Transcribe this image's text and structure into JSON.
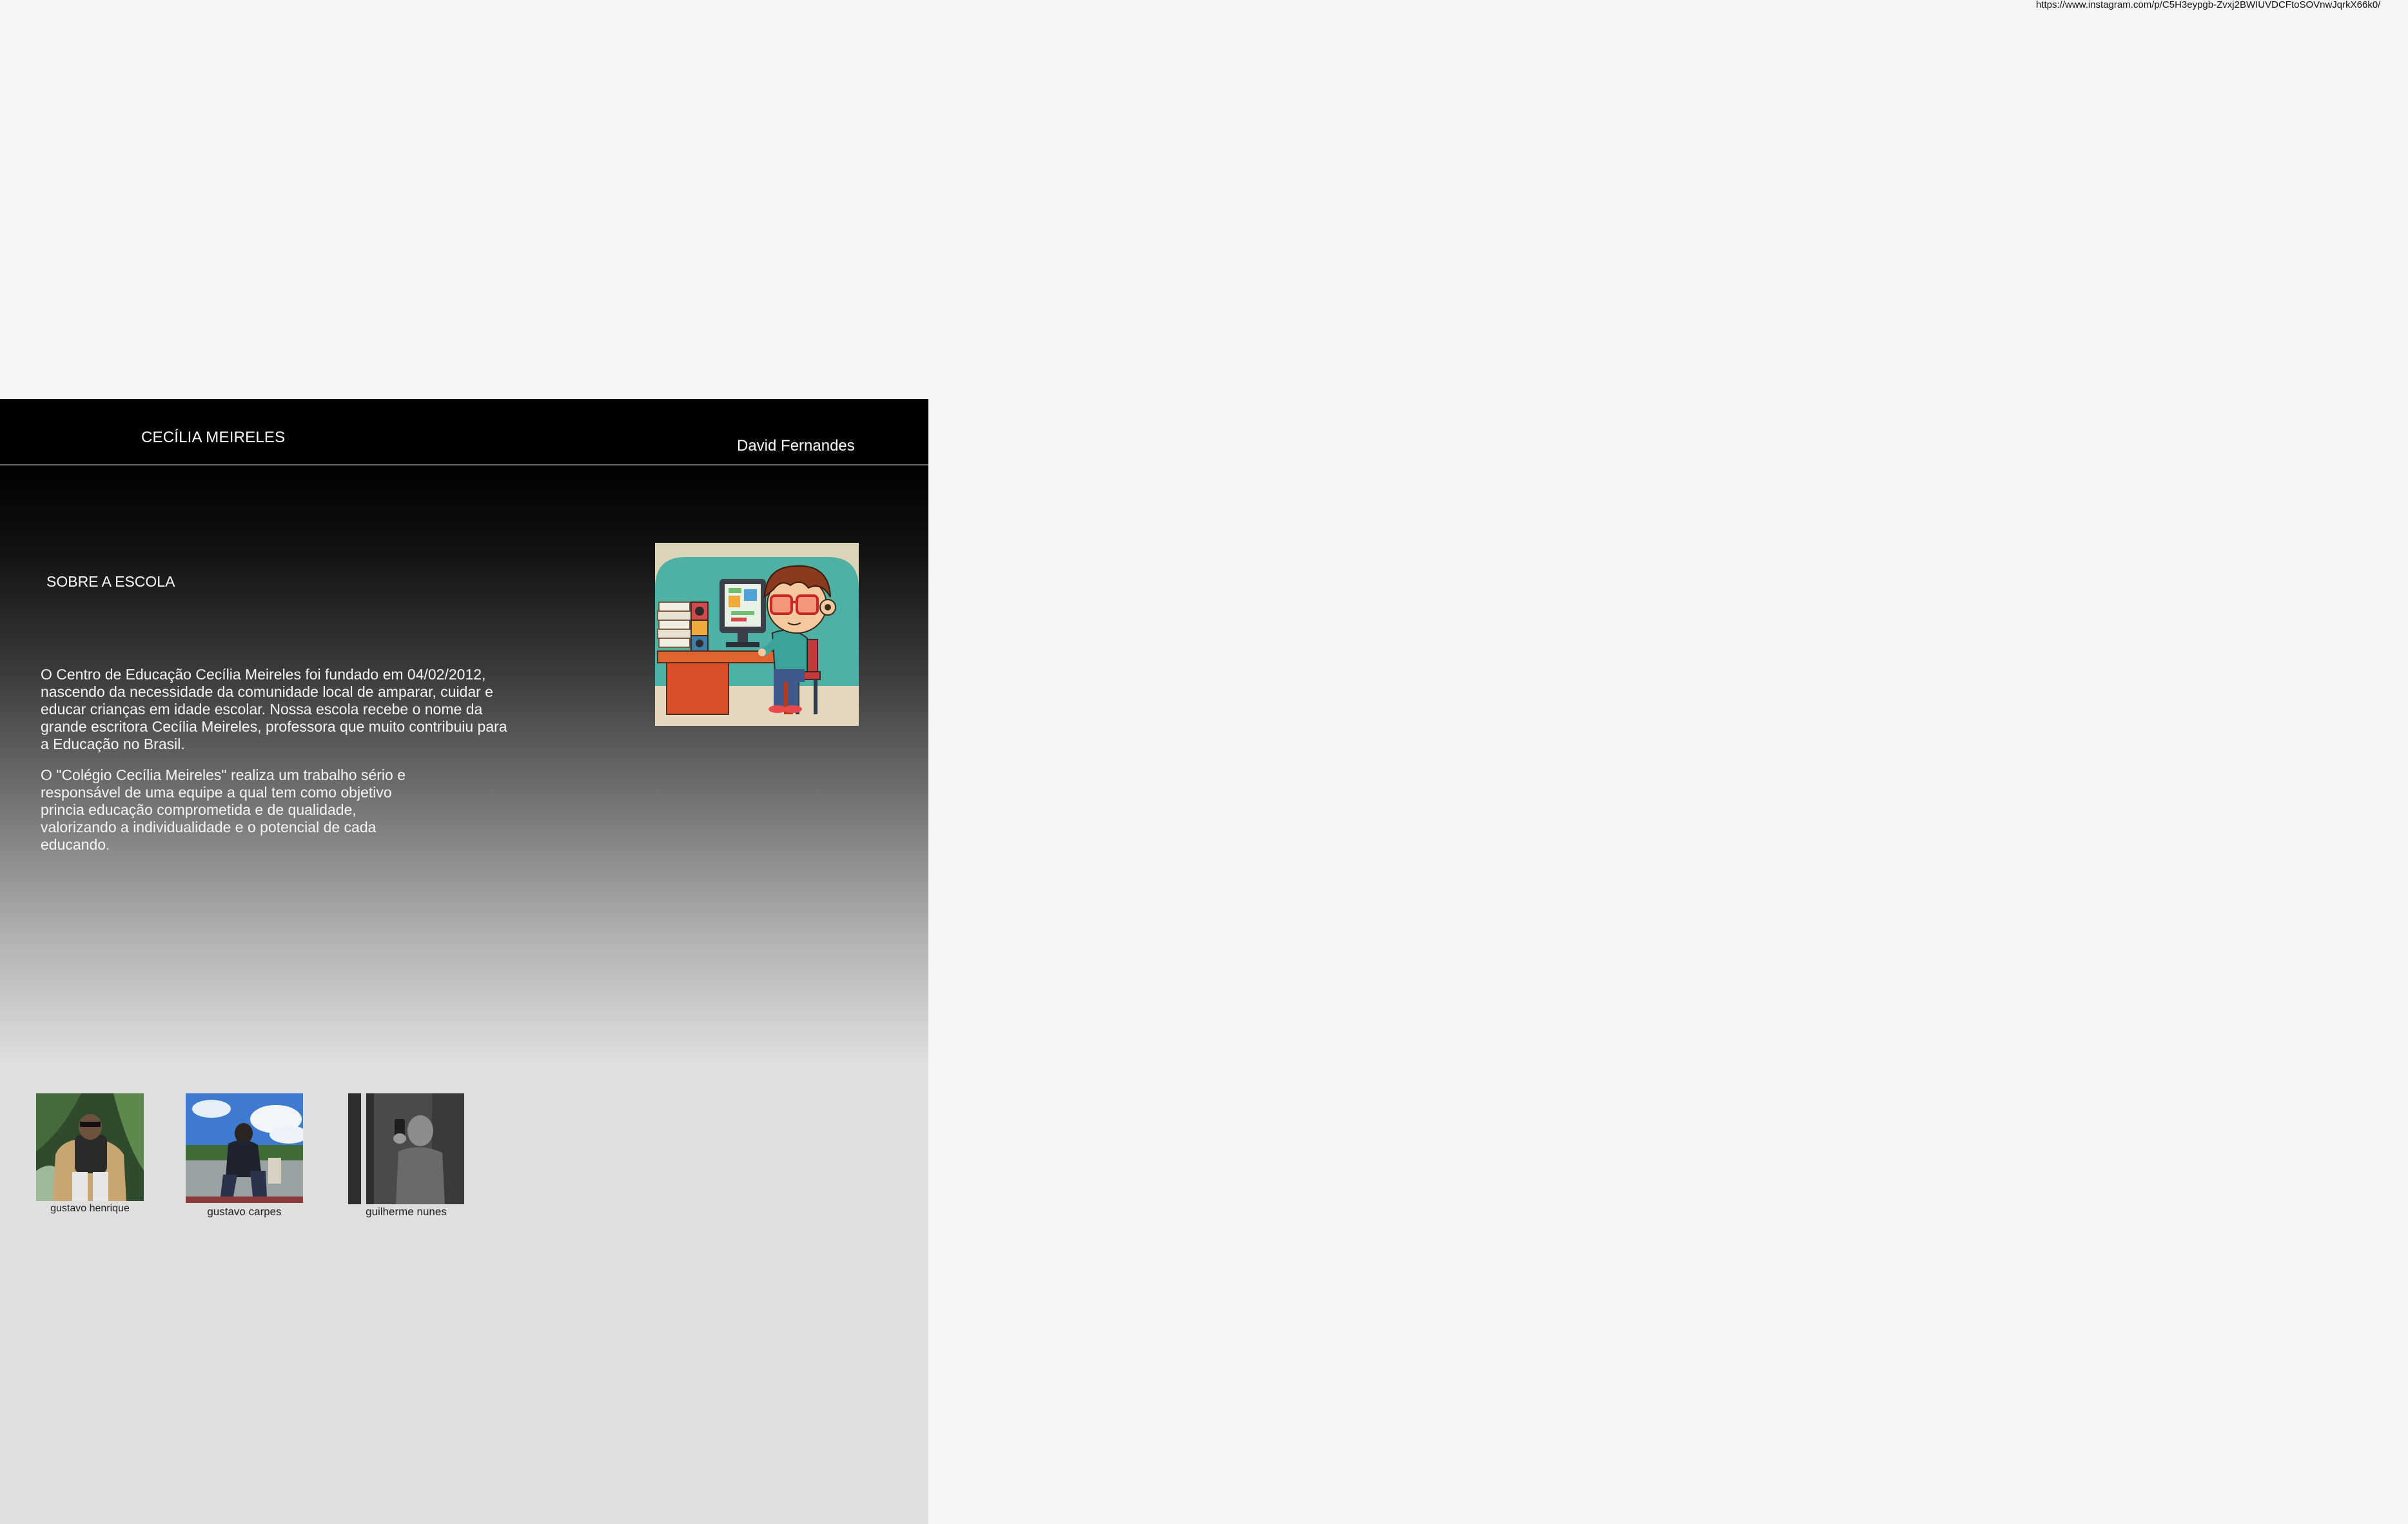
{
  "browser": {
    "url": "https://www.instagram.com/p/C5H3eypgb-Zvxj2BWIUVDCFtoSOVnwJqrkX66k0/"
  },
  "header": {
    "brand": "CECÍLIA MEIRELES",
    "author": "David Fernandes"
  },
  "about": {
    "title": "SOBRE A ESCOLA",
    "paragraph_1": "O Centro de Educação Cecília Meireles foi fundado em 04/02/2012, nascendo da necessidade da comunidade local de amparar, cuidar e educar crianças em idade escolar. Nossa escola recebe o nome da grande escritora Cecília Meireles, professora que muito contribuiu para a Educação no Brasil.",
    "paragraph_2": "O \"Colégio Cecília Meireles\" realiza um trabalho sério e responsável de uma equipe a qual tem como objetivo princia educação comprometida e de qualidade, valorizando a individualidade e o potencial de cada educando."
  },
  "illustration": {
    "icon": "kid-at-computer-illustration"
  },
  "members": [
    {
      "name": "gustavo henrique",
      "icon": "photo-man-sitting-armchair"
    },
    {
      "name": "gustavo carpes",
      "icon": "photo-couple-outdoors"
    },
    {
      "name": "guilherme nunes",
      "icon": "photo-mirror-selfie-grayscale"
    }
  ],
  "colors": {
    "page_background": "#f5f5f5",
    "header_background": "#000000",
    "frame_background": "#e1dfdd",
    "header_text": "#ffffff"
  }
}
